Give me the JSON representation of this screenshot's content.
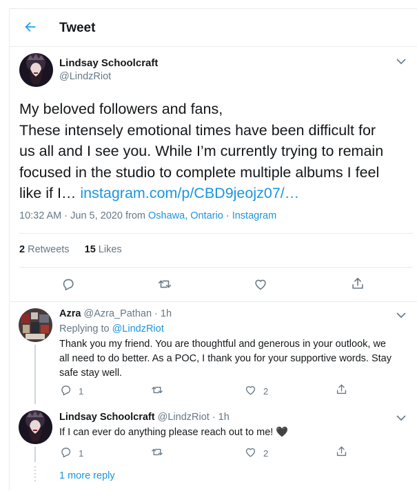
{
  "header": {
    "title": "Tweet"
  },
  "tweet": {
    "author_name": "Lindsay Schoolcraft",
    "author_handle": "@LindzRiot",
    "text_lines": [
      "My beloved followers and fans,",
      "These intensely emotional times have been difficult for",
      "us all and I see you. While I’m currently trying to remain",
      "focused in the studio to complete multiple albums I feel"
    ],
    "text_last_prefix": "like if I… ",
    "link": "instagram.com/p/CBD9jeojz07/…",
    "time_date": "10:32 AM · Jun 5, 2020 from ",
    "location": "Oshawa, Ontario",
    "separator": " · ",
    "source": "Instagram",
    "retweets_count": "2",
    "retweets_label": "Retweets",
    "likes_count": "15",
    "likes_label": "Likes"
  },
  "replies": [
    {
      "name": "Azra",
      "handle": "@Azra_Pathan",
      "time": " · 1h",
      "replying_prefix": "Replying to ",
      "replying_to": "@LindzRiot",
      "text_lines": [
        "Thank you my friend. You are thoughtful and generous in your outlook, we",
        "all need to do better. As a POC, I thank you for your supportive words. Stay",
        "safe stay well."
      ],
      "reply_count": "1",
      "like_count": "2"
    },
    {
      "name": "Lindsay Schoolcraft",
      "handle": "@LindzRiot",
      "time": " · 1h",
      "text": "If I can ever do anything please reach out to me! 🖤",
      "reply_count": "1",
      "like_count": "2"
    }
  ],
  "more_replies": "1 more reply",
  "icons": {
    "back": "arrow-left-icon",
    "menu": "chevron-down-icon",
    "reply": "reply-icon",
    "retweet": "retweet-icon",
    "like": "heart-icon",
    "share": "share-icon"
  },
  "colors": {
    "accent": "#1da1f2",
    "link": "#1b95e0",
    "muted": "#657786",
    "divider": "#e6ecf0"
  }
}
